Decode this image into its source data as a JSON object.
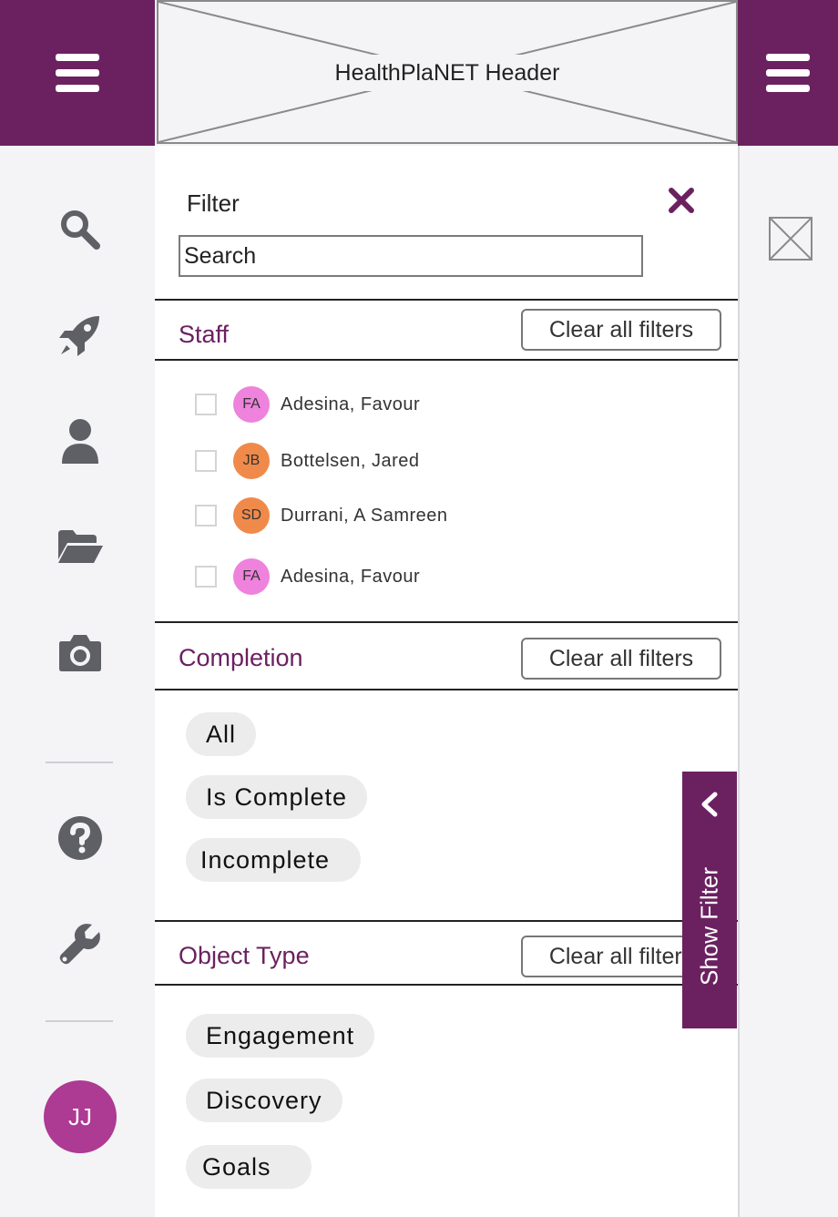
{
  "header": {
    "title": "HealthPlaNET Header"
  },
  "rail": {
    "icons": [
      "search-icon",
      "rocket-icon",
      "user-icon",
      "folder-open-icon",
      "camera-icon",
      "question-circle-icon",
      "wrench-icon"
    ],
    "avatar_initials": "JJ"
  },
  "filter": {
    "title": "Filter",
    "search_placeholder": "Search"
  },
  "sections": {
    "staff": {
      "title": "Staff",
      "clear_label": "Clear all filters",
      "items": [
        {
          "initials": "FA",
          "name": "Adesina, Favour",
          "color": "#ee82dc",
          "checked": false
        },
        {
          "initials": "JB",
          "name": "Bottelsen, Jared",
          "color": "#ef8a4b",
          "checked": false
        },
        {
          "initials": "SD",
          "name": "Durrani, A Samreen",
          "color": "#ef8a4b",
          "checked": false
        },
        {
          "initials": "FA",
          "name": "Adesina, Favour",
          "color": "#ee82dc",
          "checked": false
        }
      ]
    },
    "completion": {
      "title": "Completion",
      "clear_label": "Clear all filters",
      "options": [
        "All",
        "Is Complete",
        "Incomplete"
      ]
    },
    "object_type": {
      "title": "Object Type",
      "clear_label": "Clear all filters",
      "options": [
        "Engagement",
        "Discovery",
        "Goals"
      ]
    }
  },
  "show_filter": {
    "label": "Show Filter"
  },
  "colors": {
    "brand": "#6b2160",
    "avatar": "#ad3a93",
    "icon": "#5f6066",
    "chip": "#ececec"
  }
}
